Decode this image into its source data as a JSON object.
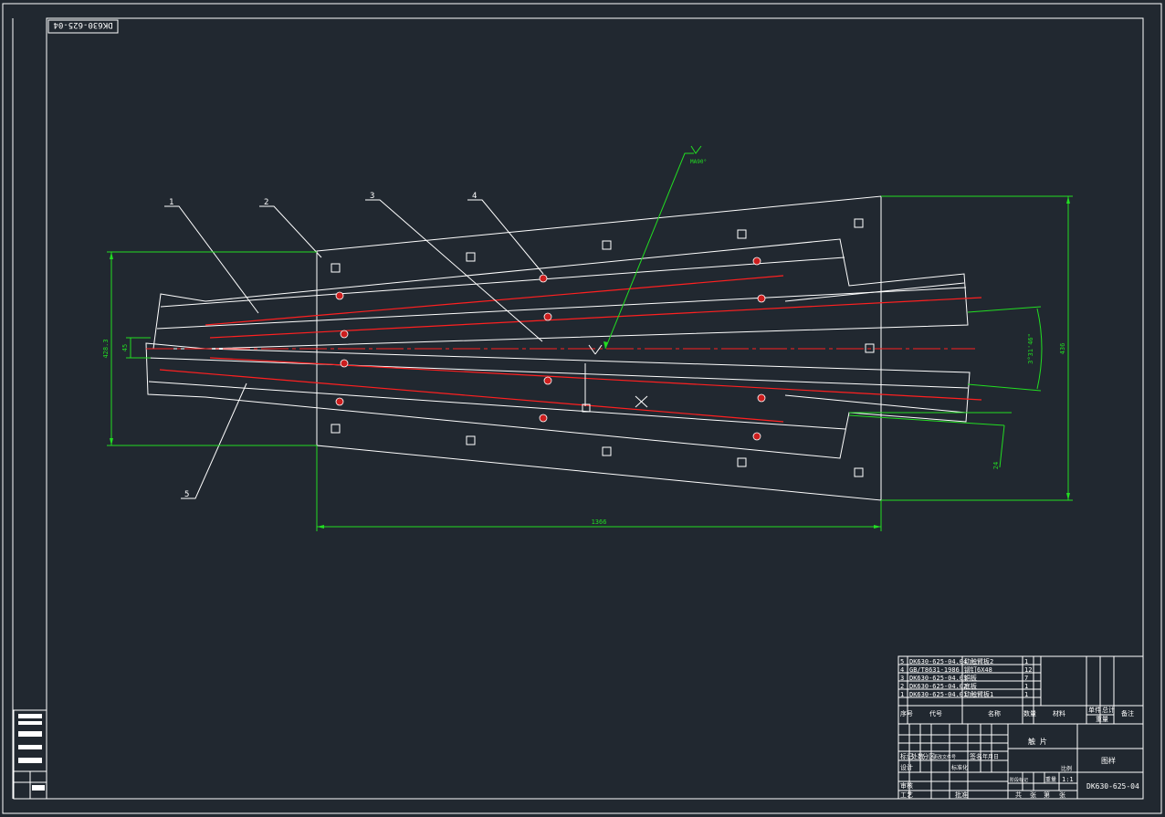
{
  "drawing": {
    "number": "DK630-625-04",
    "number_rotated": "DK630-625-04"
  },
  "callouts": [
    "1",
    "2",
    "3",
    "4",
    "5"
  ],
  "dimensions": {
    "total_length": "1366",
    "total_height": "436",
    "left_height": "428.3",
    "offset": "45",
    "slope": "3°31'46\"",
    "gap": "24",
    "weld_symbol": "MA90°"
  },
  "bom": {
    "rows": [
      {
        "no": "5",
        "code": "DK630-625-04.04",
        "name": "动触臂板2",
        "qty": "1"
      },
      {
        "no": "4",
        "code": "GB/T8631-1986",
        "name": "铆钉6X48",
        "qty": "12"
      },
      {
        "no": "3",
        "code": "DK630-625-04.03",
        "name": "铜板",
        "qty": "7"
      },
      {
        "no": "2",
        "code": "DK630-625-04.02",
        "name": "底板",
        "qty": "1"
      },
      {
        "no": "1",
        "code": "DK630-625-04.01",
        "name": "动触臂板1",
        "qty": "1"
      }
    ],
    "headers": {
      "no": "序号",
      "code": "代号",
      "name": "名称",
      "qty": "数量",
      "mat": "材料",
      "single": "单件",
      "total": "总计",
      "weight": "重量",
      "remark": "备注"
    }
  },
  "title_block": {
    "part_name": "触 片",
    "unit": "图样",
    "drawing_no": "DK630-625-04",
    "scale": "1:1",
    "labels": {
      "mark": "标记",
      "count": "处数",
      "zone": "分区",
      "change_doc": "更改文件号",
      "sign": "签名",
      "date": "年月日",
      "design": "设计",
      "standard": "标准化",
      "stage": "阶段标记",
      "weight": "重量",
      "ratio": "比例",
      "review": "审核",
      "process": "工艺",
      "approve": "批准",
      "sheet_total": "共",
      "sheet": "张",
      "sheet_no": "第"
    }
  }
}
